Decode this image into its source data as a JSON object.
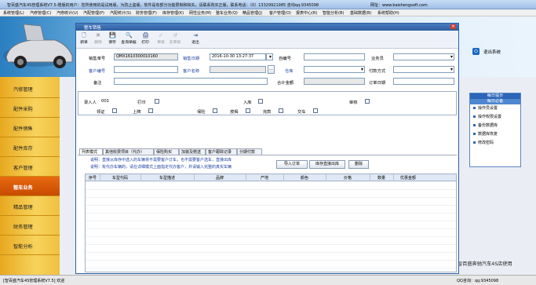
{
  "app": {
    "title": "智百盛汽车4S管理系统V7.5-赠版的用户：您所使用的是试用版，为防止盗版，软件是有部分功能限制和缺失，请联系购买正版，联系电话：（0）13329921985  咨询qq:9345098",
    "website_label": "网址：www.baishengsoft.com"
  },
  "menu": [
    "系统管理(L)",
    "汽修管理(C)",
    "汽修统计(U)",
    "汽配管理(P)",
    "汽配统计(S)",
    "财务管理(F)",
    "库存管理(K)",
    "网性业务(M)",
    "整车业务(Q)",
    "精品管理(J)",
    "客户管理(O)",
    "报表中心(R)",
    "智能分析(B)",
    "基础数据(B)",
    "系统帮助(H)"
  ],
  "sidebar": {
    "items": [
      {
        "label": "汽修管理"
      },
      {
        "label": "配件采购"
      },
      {
        "label": "配件销售"
      },
      {
        "label": "配件库存"
      },
      {
        "label": "客户管理"
      },
      {
        "label": "整车业务"
      },
      {
        "label": "精品管理"
      },
      {
        "label": "财务管理"
      },
      {
        "label": "智能分析"
      }
    ]
  },
  "logout_label": "退出系统",
  "right_panel": {
    "header1": "每日提示",
    "header2": "每日必备",
    "items": [
      "操作员设置",
      "操作权限设置",
      "备份数据库",
      "数据库恢复",
      "修改密码"
    ]
  },
  "bottom_ad": "智百盛奔驰汽车4S店使用",
  "status": {
    "left": "[智百盛汽车4S管理系统V7.5] 欢迎",
    "right": "QQ咨询：qq:9345098"
  },
  "dialog": {
    "title": "整车销售",
    "close": "✕",
    "toolbar": [
      {
        "label": "新单",
        "enabled": true
      },
      {
        "label": "删除",
        "enabled": false
      },
      {
        "label": "保存",
        "enabled": true
      },
      {
        "label": "查询单据",
        "enabled": true
      },
      {
        "label": "打印",
        "enabled": true
      },
      {
        "label": "审核",
        "enabled": false
      },
      {
        "label": "反审核",
        "enabled": false
      },
      {
        "label": "退出",
        "enabled": true
      }
    ],
    "form": {
      "order_no_label": "销售单号",
      "order_no": "QMX1610300010160",
      "date_label": "销售日期",
      "date": "2016-10-30 13:27:37",
      "invoice_label": "自编号",
      "salesman_label": "业务员",
      "customer_no_label": "客户编号",
      "customer_name_label": "客户名称",
      "browse_btn": "...",
      "warehouse_label": "仓库",
      "payment_label": "付款方式",
      "remark_label": "备注",
      "total_label": "合计金额",
      "date_in_label": "订单日期"
    },
    "info": {
      "entered_by_label": "录入人",
      "entered_by": "001",
      "print_label": "打印",
      "warehouse_in_label": "入库",
      "audit_label": "审核",
      "checks": [
        "领证",
        "上牌",
        "保险",
        "按揭",
        "完款",
        "交车"
      ]
    },
    "tabs": [
      "列表模式",
      "其他收费项目（代办）",
      "保险购买",
      "加装及赠送",
      "客户跟踪记录",
      "分期付款"
    ],
    "notes": [
      "说明：直接从库存中选入的车辆将不需要客户订车，也不需要客户选车，直接出库",
      "说明：有代办车辆的，请在详细模式上面指定代办客户，并请输入完整的真实车辆"
    ],
    "buttons": {
      "import": "导入订单",
      "stock": "库存直接出库",
      "delete": "删除"
    },
    "grid_columns": [
      "序号",
      "车型代码",
      "车型描述",
      "品牌",
      "产地",
      "颜色",
      "价格",
      "数量",
      "优惠金额"
    ]
  },
  "colors": {
    "accent": "#2c5ea0",
    "sidebar_active": "#e05a08",
    "sidebar": "#f2c446"
  }
}
